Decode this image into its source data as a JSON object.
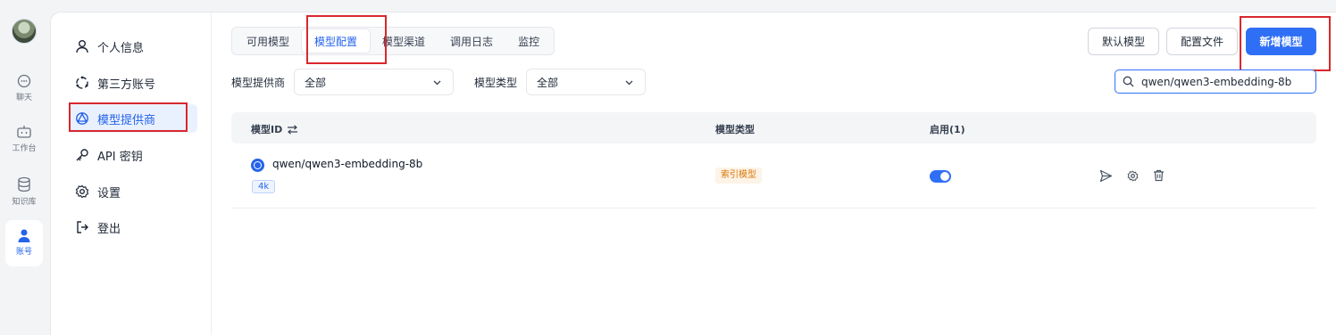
{
  "rail": {
    "items": [
      {
        "label": "聊天",
        "icon": "chat-icon"
      },
      {
        "label": "工作台",
        "icon": "robot-icon"
      },
      {
        "label": "知识库",
        "icon": "database-icon"
      },
      {
        "label": "账号",
        "icon": "user-icon"
      }
    ]
  },
  "settings_nav": {
    "items": [
      {
        "label": "个人信息",
        "icon": "user-icon"
      },
      {
        "label": "第三方账号",
        "icon": "link-icon"
      },
      {
        "label": "模型提供商",
        "icon": "model-provider-icon"
      },
      {
        "label": "API 密钥",
        "icon": "key-icon"
      },
      {
        "label": "设置",
        "icon": "gear-icon"
      },
      {
        "label": "登出",
        "icon": "logout-icon"
      }
    ]
  },
  "tabs": [
    {
      "label": "可用模型"
    },
    {
      "label": "模型配置"
    },
    {
      "label": "模型渠道"
    },
    {
      "label": "调用日志"
    },
    {
      "label": "监控"
    }
  ],
  "toolbar": {
    "default_model": "默认模型",
    "config_file": "配置文件",
    "add_model": "新增模型"
  },
  "filters": {
    "provider_label": "模型提供商",
    "provider_value": "全部",
    "type_label": "模型类型",
    "type_value": "全部"
  },
  "search": {
    "value": "qwen/qwen3-embedding-8b"
  },
  "table": {
    "headers": {
      "model_id": "模型ID",
      "model_type": "模型类型",
      "enabled": "启用(1)"
    },
    "rows": [
      {
        "model_id": "qwen/qwen3-embedding-8b",
        "context": "4k",
        "type": "索引模型",
        "enabled": true
      }
    ]
  },
  "colors": {
    "accent": "#2f6ff6",
    "highlight_box": "#d9272e",
    "type_tag": "#d97706"
  }
}
